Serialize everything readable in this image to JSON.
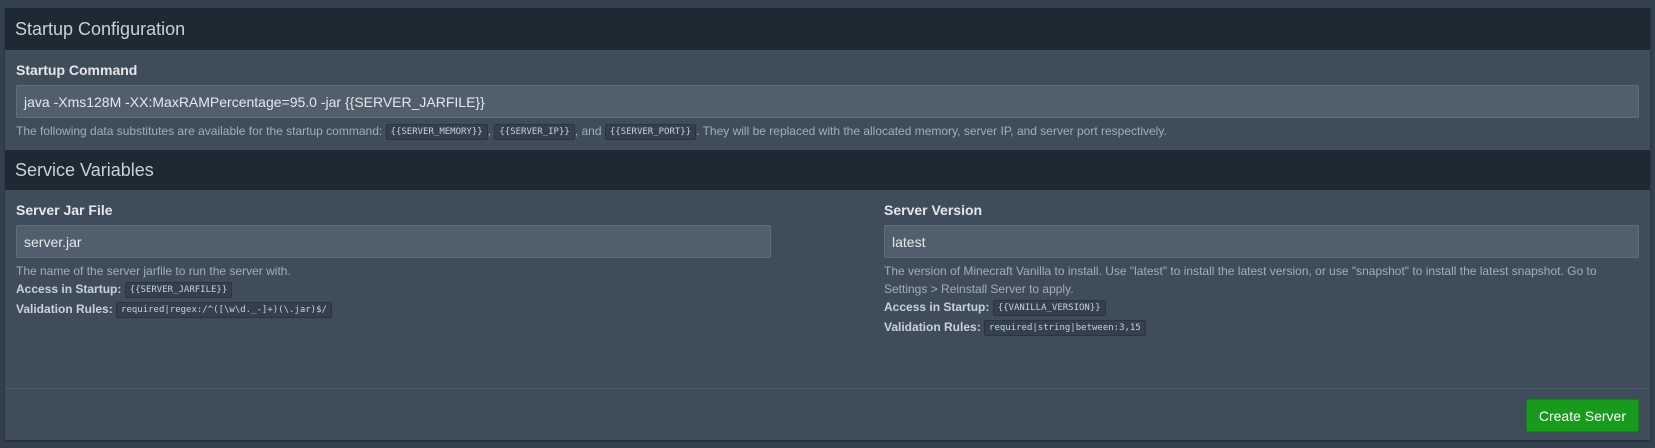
{
  "startup": {
    "title": "Startup Configuration",
    "command_label": "Startup Command",
    "command_value": "java -Xms128M -XX:MaxRAMPercentage=95.0 -jar {{SERVER_JARFILE}}",
    "help_prefix": "The following data substitutes are available for the startup command:",
    "var_memory": "{{SERVER_MEMORY}}",
    "sep1": ",",
    "var_ip": "{{SERVER_IP}}",
    "sep2": ", and",
    "var_port": "{{SERVER_PORT}}",
    "help_suffix": ". They will be replaced with the allocated memory, server IP, and server port respectively."
  },
  "service": {
    "title": "Service Variables",
    "access_label": "Access in Startup:",
    "rules_label": "Validation Rules:",
    "variables": [
      {
        "label": "Server Jar File",
        "value": "server.jar",
        "description": "The name of the server jarfile to run the server with.",
        "env": "{{SERVER_JARFILE}}",
        "rules": "required|regex:/^([\\w\\d._-]+)(\\.jar)$/"
      },
      {
        "label": "Server Version",
        "value": "latest",
        "description": "The version of Minecraft Vanilla to install. Use \"latest\" to install the latest version, or use \"snapshot\" to install the latest snapshot. Go to Settings > Reinstall Server to apply.",
        "env": "{{VANILLA_VERSION}}",
        "rules": "required|string|between:3,15"
      }
    ]
  },
  "footer": {
    "create_label": "Create Server"
  },
  "colors": {
    "header_bg": "#1f2933",
    "panel_bg": "#3f4d5a",
    "input_bg": "#515f6c",
    "button_green": "#189a1c"
  }
}
